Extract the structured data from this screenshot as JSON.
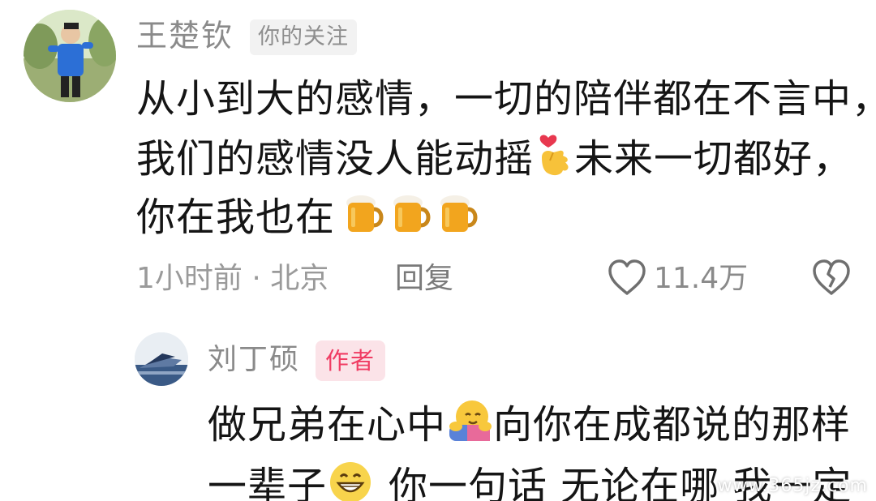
{
  "comment": {
    "username": "王楚钦",
    "follow_tag": "你的关注",
    "lines": {
      "l1": "从小到大的感情，一切的陪伴都在不言中，",
      "l2a": "我们的感情没人能动摇",
      "l2b": "未来一切都好，",
      "l3": "你在我也在"
    },
    "time_location": "1小时前 · 北京",
    "reply_label": "回复",
    "like_count": "11.4万"
  },
  "reply": {
    "username": "刘丁硕",
    "author_tag": "作者",
    "lines": {
      "l1a": "做兄弟在心中",
      "l1b": "向你在成都说的那样",
      "l2a": "一辈子",
      "l2b": "你一句话 无论在哪 我一定"
    }
  },
  "watermark": "www.365jz.com",
  "icons": {
    "like": "heart-outline-icon",
    "dislike": "broken-heart-icon",
    "emoji_heart_hand": "finger-heart-emoji",
    "emoji_beer": "beer-mug-emoji",
    "emoji_hug": "hugging-face-emoji",
    "emoji_grin": "grinning-face-emoji"
  },
  "colors": {
    "author_tag_bg": "#fbe3e8",
    "author_tag_text": "#f03c63",
    "meta_text": "#9a9a9a"
  }
}
